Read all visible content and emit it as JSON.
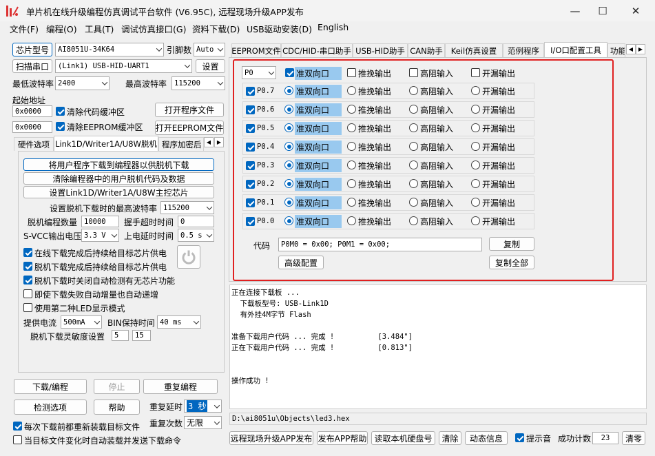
{
  "window": {
    "title": "单片机在线升级编程仿真调试平台软件 (V6.95C), 远程现场升级APP发布",
    "minimize": "—",
    "maximize": "☐",
    "close": "✕"
  },
  "menu": [
    "文件(F)",
    "编程(O)",
    "工具(T)",
    "调试仿真接口(G)",
    "资料下载(D)",
    "USB驱动安装(D)",
    "English"
  ],
  "left": {
    "chip_model_btn": "芯片型号",
    "chip_model": "AI8051U-34K64",
    "pin_count_label": "引脚数",
    "pin_count": "Auto",
    "scan_port_btn": "扫描串口",
    "port": "(Link1) USB-HID-UART1",
    "settings_btn": "设置",
    "min_baud_label": "最低波特率",
    "min_baud": "2400",
    "max_baud_label": "最高波特率",
    "max_baud": "115200",
    "start_addr_label": "起始地址",
    "addr1": "0x0000",
    "clear_code_label": "清除代码缓冲区",
    "open_prog_btn": "打开程序文件",
    "addr2": "0x0000",
    "clear_eeprom_label": "清除EEPROM缓冲区",
    "open_eeprom_btn": "打开EEPROM文件",
    "tabs": [
      "硬件选项",
      "Link1D/Writer1A/U8W脱机",
      "程序加密后"
    ],
    "offline": {
      "btn1": "将用户程序下载到编程器以供脱机下载",
      "btn2": "清除编程器中的用户脱机代码及数据",
      "btn3": "设置Link1D/Writer1A/U8W主控芯片",
      "max_baud_label": "设置脱机下载时的最高波特率",
      "max_baud": "115200",
      "count_label": "脱机编程数量",
      "count": "10000",
      "timeout_label": "握手超时时间",
      "timeout": "0",
      "svcc_label": "S-VCC输出电压",
      "svcc": "3.3 V",
      "power_delay_label": "上电延时时间",
      "power_delay": "0.5 s",
      "opt1": "在线下载完成后持续给目标芯片供电",
      "opt2": "脱机下载完成后持续给目标芯片供电",
      "opt3": "脱机下载时关闭自动检测有无芯片功能",
      "opt4": "即使下载失败自动增量也自动递增",
      "opt5": "使用第二种LED显示模式",
      "current_label": "提供电流",
      "current": "500mA",
      "bin_label": "BIN保持时间",
      "bin": "40 ms",
      "sens_label": "脱机下载灵敏度设置",
      "sens1": "5",
      "sens2": "15"
    },
    "download_btn": "下载/编程",
    "stop_btn": "停止",
    "reprogram_btn": "重复编程",
    "detect_btn": "检测选项",
    "help_btn": "帮助",
    "repeat_delay_label": "重复延时",
    "repeat_delay": "3 秒",
    "repeat_count_label": "重复次数",
    "repeat_count": "无限",
    "reload_label": "每次下载前都重新装载目标文件",
    "auto_send_label": "当目标文件变化时自动装载并发送下载命令"
  },
  "right": {
    "tabs": [
      "EEPROM文件",
      "CDC/HID-串口助手",
      "USB-HID助手",
      "CAN助手",
      "Keil仿真设置",
      "范例程序",
      "I/O口配置工具",
      "功能"
    ],
    "port_select": "P0",
    "mode_bidir": "准双向口",
    "mode_pushpull": "推挽输出",
    "mode_highz": "高阻输入",
    "mode_od": "开漏输出",
    "pins": [
      "P0.7",
      "P0.6",
      "P0.5",
      "P0.4",
      "P0.3",
      "P0.2",
      "P0.1",
      "P0.0"
    ],
    "code_label": "代码",
    "code": "P0M0 = 0x00; P0M1 = 0x00;",
    "copy_btn": "复制",
    "advanced_btn": "高级配置",
    "copy_all_btn": "复制全部",
    "log": "正在连接下载板 ...\n  下载板型号: USB-Link1D\n  有外挂4M字节 Flash\n\n准备下载用户代码 ... 完成 !          [3.484\"]\n正在下载用户代码 ... 完成 !          [0.813\"]\n\n\n操作成功 !",
    "file_path": "D:\\ai8051u\\Objects\\led3.hex",
    "remote_btn": "远程现场升级APP发布",
    "publish_help_btn": "发布APP帮助",
    "read_disk_btn": "读取本机硬盘号",
    "clear_btn": "清除",
    "anim_btn": "动态信息",
    "beep_label": "提示音",
    "success_label": "成功计数",
    "success_count": "23",
    "zero_btn": "清零"
  },
  "colors": {
    "accent": "#0067c0",
    "highlight": "#99c9ef",
    "red_box": "#e02020"
  }
}
